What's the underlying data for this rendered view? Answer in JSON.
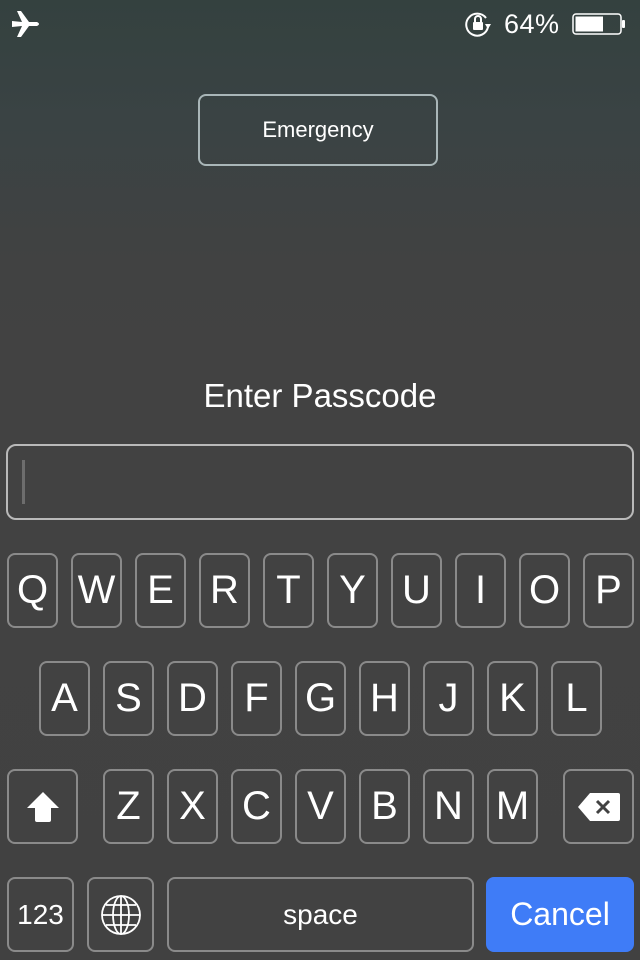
{
  "status_bar": {
    "airplane_icon": "airplane-icon",
    "rotation_lock_icon": "rotation-lock-icon",
    "battery_percent": "64%",
    "battery_level": 0.64
  },
  "emergency_label": "Emergency",
  "title": "Enter Passcode",
  "passcode_field": {
    "value": "",
    "placeholder": ""
  },
  "keyboard": {
    "row1": [
      "Q",
      "W",
      "E",
      "R",
      "T",
      "Y",
      "U",
      "I",
      "O",
      "P"
    ],
    "row2": [
      "A",
      "S",
      "D",
      "F",
      "G",
      "H",
      "J",
      "K",
      "L"
    ],
    "row3": [
      "Z",
      "X",
      "C",
      "V",
      "B",
      "N",
      "M"
    ],
    "shift_icon": "shift-arrow-icon",
    "delete_icon": "backspace-icon",
    "numbers_label": "123",
    "globe_icon": "globe-icon",
    "space_label": "space",
    "cancel_label": "Cancel"
  },
  "colors": {
    "accent": "#3f7cf7",
    "background": "#424242"
  }
}
